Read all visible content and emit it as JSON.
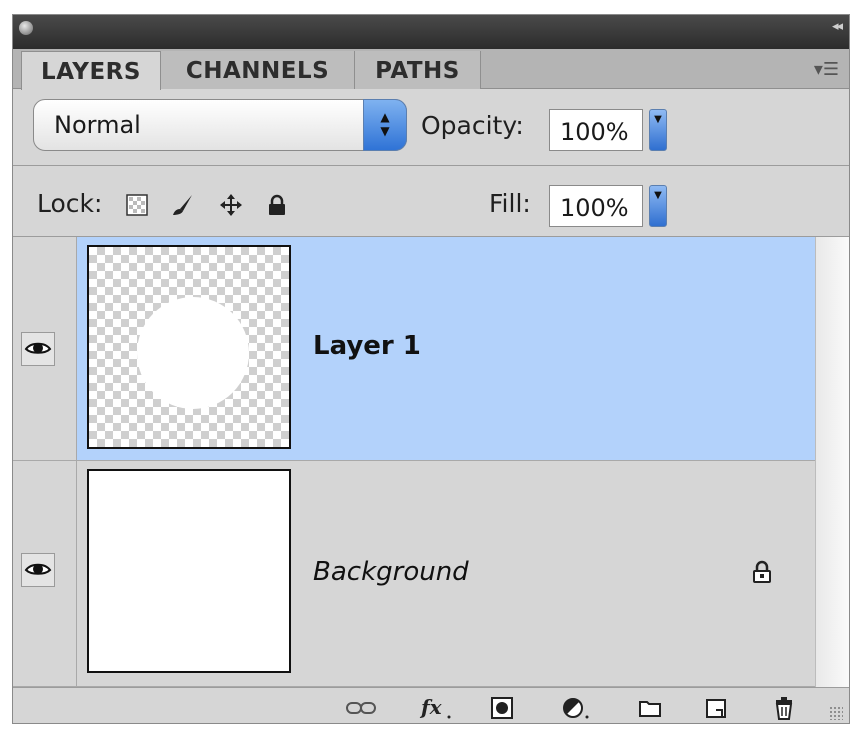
{
  "tabs": [
    {
      "label": "LAYERS",
      "active": true
    },
    {
      "label": "CHANNELS",
      "active": false
    },
    {
      "label": "PATHS",
      "active": false
    }
  ],
  "blend": {
    "mode": "Normal",
    "options": [
      "Normal"
    ]
  },
  "opacity": {
    "label": "Opacity:",
    "value": "100%"
  },
  "lock": {
    "label": "Lock:",
    "icons": [
      "lock-transparent-pixels-icon",
      "lock-image-pixels-icon",
      "lock-position-icon",
      "lock-all-icon"
    ]
  },
  "fill": {
    "label": "Fill:",
    "value": "100%"
  },
  "layers": [
    {
      "name": "Layer 1",
      "selected": true,
      "visible": true,
      "thumbnail": "white-circle-on-transparency",
      "locked": false
    },
    {
      "name": "Background",
      "selected": false,
      "visible": true,
      "thumbnail": "white-fill",
      "locked": true,
      "italic": true
    }
  ],
  "toolbar_icons": [
    "link-layers-icon",
    "layer-style-fx-icon",
    "add-mask-icon",
    "adjustment-layer-icon",
    "new-group-folder-icon",
    "new-layer-icon",
    "trash-icon"
  ],
  "colors": {
    "selected_row": "#b3d2fb",
    "panel_bg": "#d6d6d6",
    "accent_blue": "#2f73d6"
  }
}
